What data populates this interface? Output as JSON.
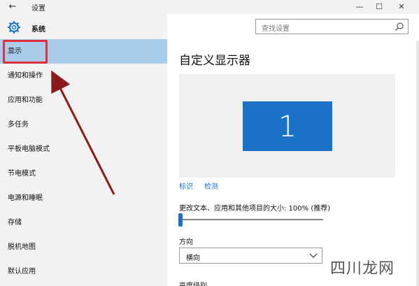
{
  "window": {
    "back_glyph": "←",
    "title": "设置",
    "min_glyph": "—",
    "max_glyph": "☐",
    "close_glyph": "✕"
  },
  "sidebar": {
    "section_icon": "gear-icon",
    "section_title": "系统",
    "items": [
      {
        "label": "显示",
        "selected": true
      },
      {
        "label": "通知和操作",
        "selected": false
      },
      {
        "label": "应用和功能",
        "selected": false
      },
      {
        "label": "多任务",
        "selected": false
      },
      {
        "label": "平板电脑模式",
        "selected": false
      },
      {
        "label": "节电模式",
        "selected": false
      },
      {
        "label": "电源和睡眠",
        "selected": false
      },
      {
        "label": "存储",
        "selected": false
      },
      {
        "label": "脱机地图",
        "selected": false
      },
      {
        "label": "默认应用",
        "selected": false
      }
    ]
  },
  "search": {
    "placeholder": "查找设置",
    "icon": "search-icon"
  },
  "main": {
    "title": "自定义显示器",
    "monitor_number": "1",
    "links": {
      "identify": "标识",
      "detect": "检测"
    },
    "scale_label": "更改文本、应用和其他项目的大小: 100% (推荐)",
    "scale_value": 0.0,
    "orientation_label": "方向",
    "orientation_value": "横向",
    "brightness_label": "亮度级别"
  },
  "watermark": "四川龙网",
  "colors": {
    "accent": "#1a73c9",
    "selected_bg": "#a9ccea",
    "highlight_red": "#e0303c",
    "arrow_red": "#8b1a1a",
    "sidebar_bg": "#f2f2f2"
  }
}
